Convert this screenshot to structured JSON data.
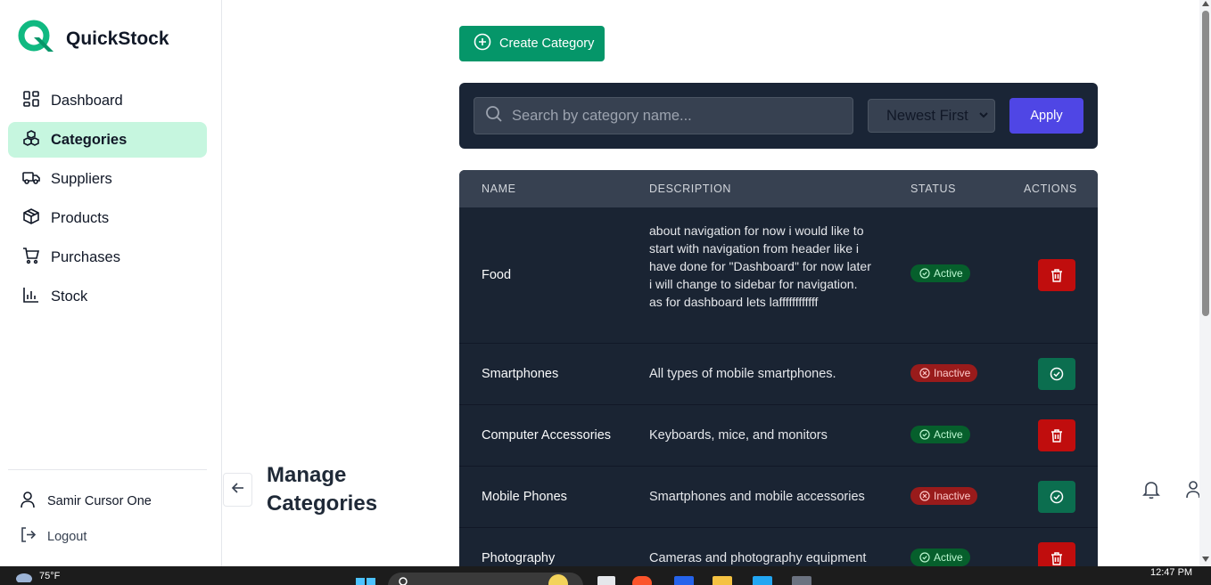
{
  "brand": {
    "name": "QuickStock",
    "accent": "#10b981"
  },
  "sidebar": {
    "items": [
      {
        "label": "Dashboard",
        "icon": "dashboard-grid-icon",
        "active": false
      },
      {
        "label": "Categories",
        "icon": "categories-boxes-icon",
        "active": true
      },
      {
        "label": "Suppliers",
        "icon": "truck-icon",
        "active": false
      },
      {
        "label": "Products",
        "icon": "package-icon",
        "active": false
      },
      {
        "label": "Purchases",
        "icon": "cart-icon",
        "active": false
      },
      {
        "label": "Stock",
        "icon": "bar-chart-icon",
        "active": false
      }
    ],
    "user_name": "Samir Cursor One",
    "logout_label": "Logout"
  },
  "header": {
    "page_title": "Manage Categories"
  },
  "toolbar": {
    "create_label": "Create Category"
  },
  "filters": {
    "search_placeholder": "Search by category name...",
    "sort_selected": "Newest First",
    "apply_label": "Apply"
  },
  "table": {
    "columns": [
      "NAME",
      "DESCRIPTION",
      "STATUS",
      "ACTIONS"
    ],
    "rows": [
      {
        "name": "Food",
        "description": "about navigation for now i would like to start with navigation from header like i have done for \"Dashboard\" for now later i will change to sidebar for navigation. as for dashboard lets laffffffffffff",
        "status": "Active"
      },
      {
        "name": "Smartphones",
        "description": "All types of mobile smartphones.",
        "status": "Inactive"
      },
      {
        "name": "Computer Accessories",
        "description": "Keyboards, mice, and monitors",
        "status": "Active"
      },
      {
        "name": "Mobile Phones",
        "description": "Smartphones and mobile accessories",
        "status": "Inactive"
      },
      {
        "name": "Photography",
        "description": "Cameras and photography equipment",
        "status": "Active"
      }
    ]
  },
  "taskbar": {
    "temperature": "75°F",
    "time": "12:47 PM"
  },
  "colors": {
    "active_badge": "#065f2c",
    "inactive_badge": "#991b1b",
    "delete_button": "#c00d0d",
    "activate_button": "#0b6e4f",
    "apply_button": "#4f46e5",
    "create_button": "#059669"
  }
}
